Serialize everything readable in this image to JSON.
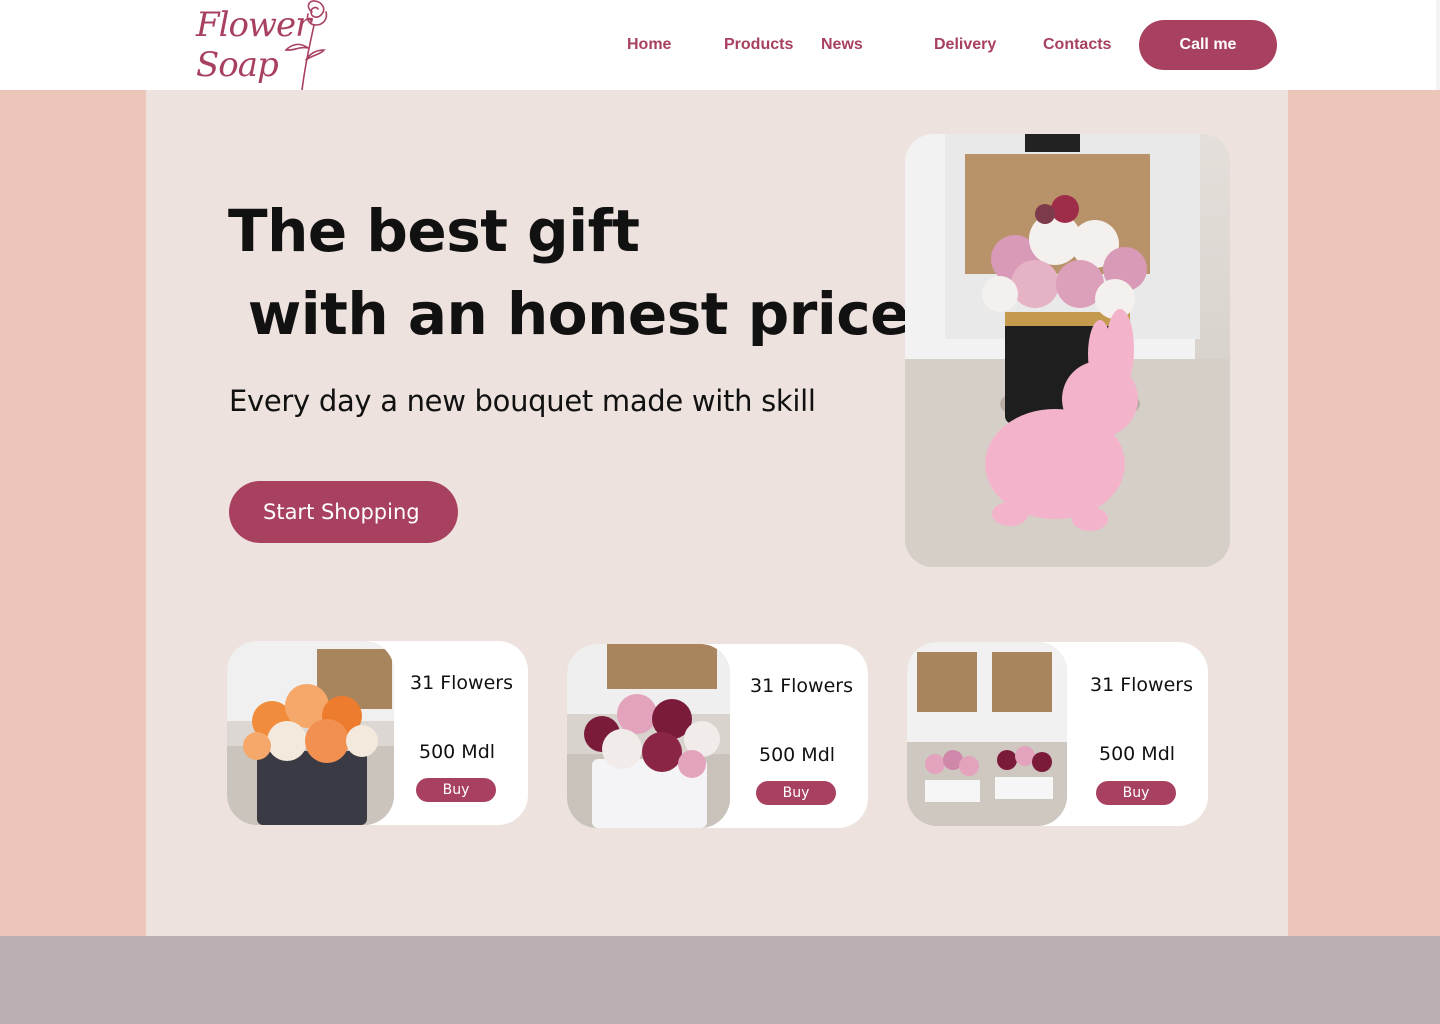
{
  "brand": {
    "logo_line1": "Flower",
    "logo_line2": "Soap",
    "accent": "#a8405f"
  },
  "nav": {
    "items": [
      {
        "label": "Home"
      },
      {
        "label": "Products"
      },
      {
        "label": "News"
      },
      {
        "label": "Delivery"
      },
      {
        "label": "Contacts"
      }
    ],
    "cta_label": "Call me"
  },
  "hero": {
    "title": "The best gift\n with an honest price",
    "subtitle": "Every day a new bouquet made with skill",
    "button_label": "Start Shopping",
    "image_icon": "rose-bouquet-with-pink-bunny-photo"
  },
  "products": [
    {
      "name": "31 Flowers",
      "price": "500 Mdl",
      "buy_label": "Buy",
      "image_icon": "orange-rose-box-photo"
    },
    {
      "name": "31 Flowers",
      "price": "500 Mdl",
      "buy_label": "Buy",
      "image_icon": "burgundy-white-rose-box-photo"
    },
    {
      "name": "31 Flowers",
      "price": "500 Mdl",
      "buy_label": "Buy",
      "image_icon": "two-small-rose-boxes-photo"
    }
  ],
  "colors": {
    "side_band": "#ecc7b9",
    "main_bg": "#ede2de",
    "footer_bg": "#bab0b4"
  }
}
